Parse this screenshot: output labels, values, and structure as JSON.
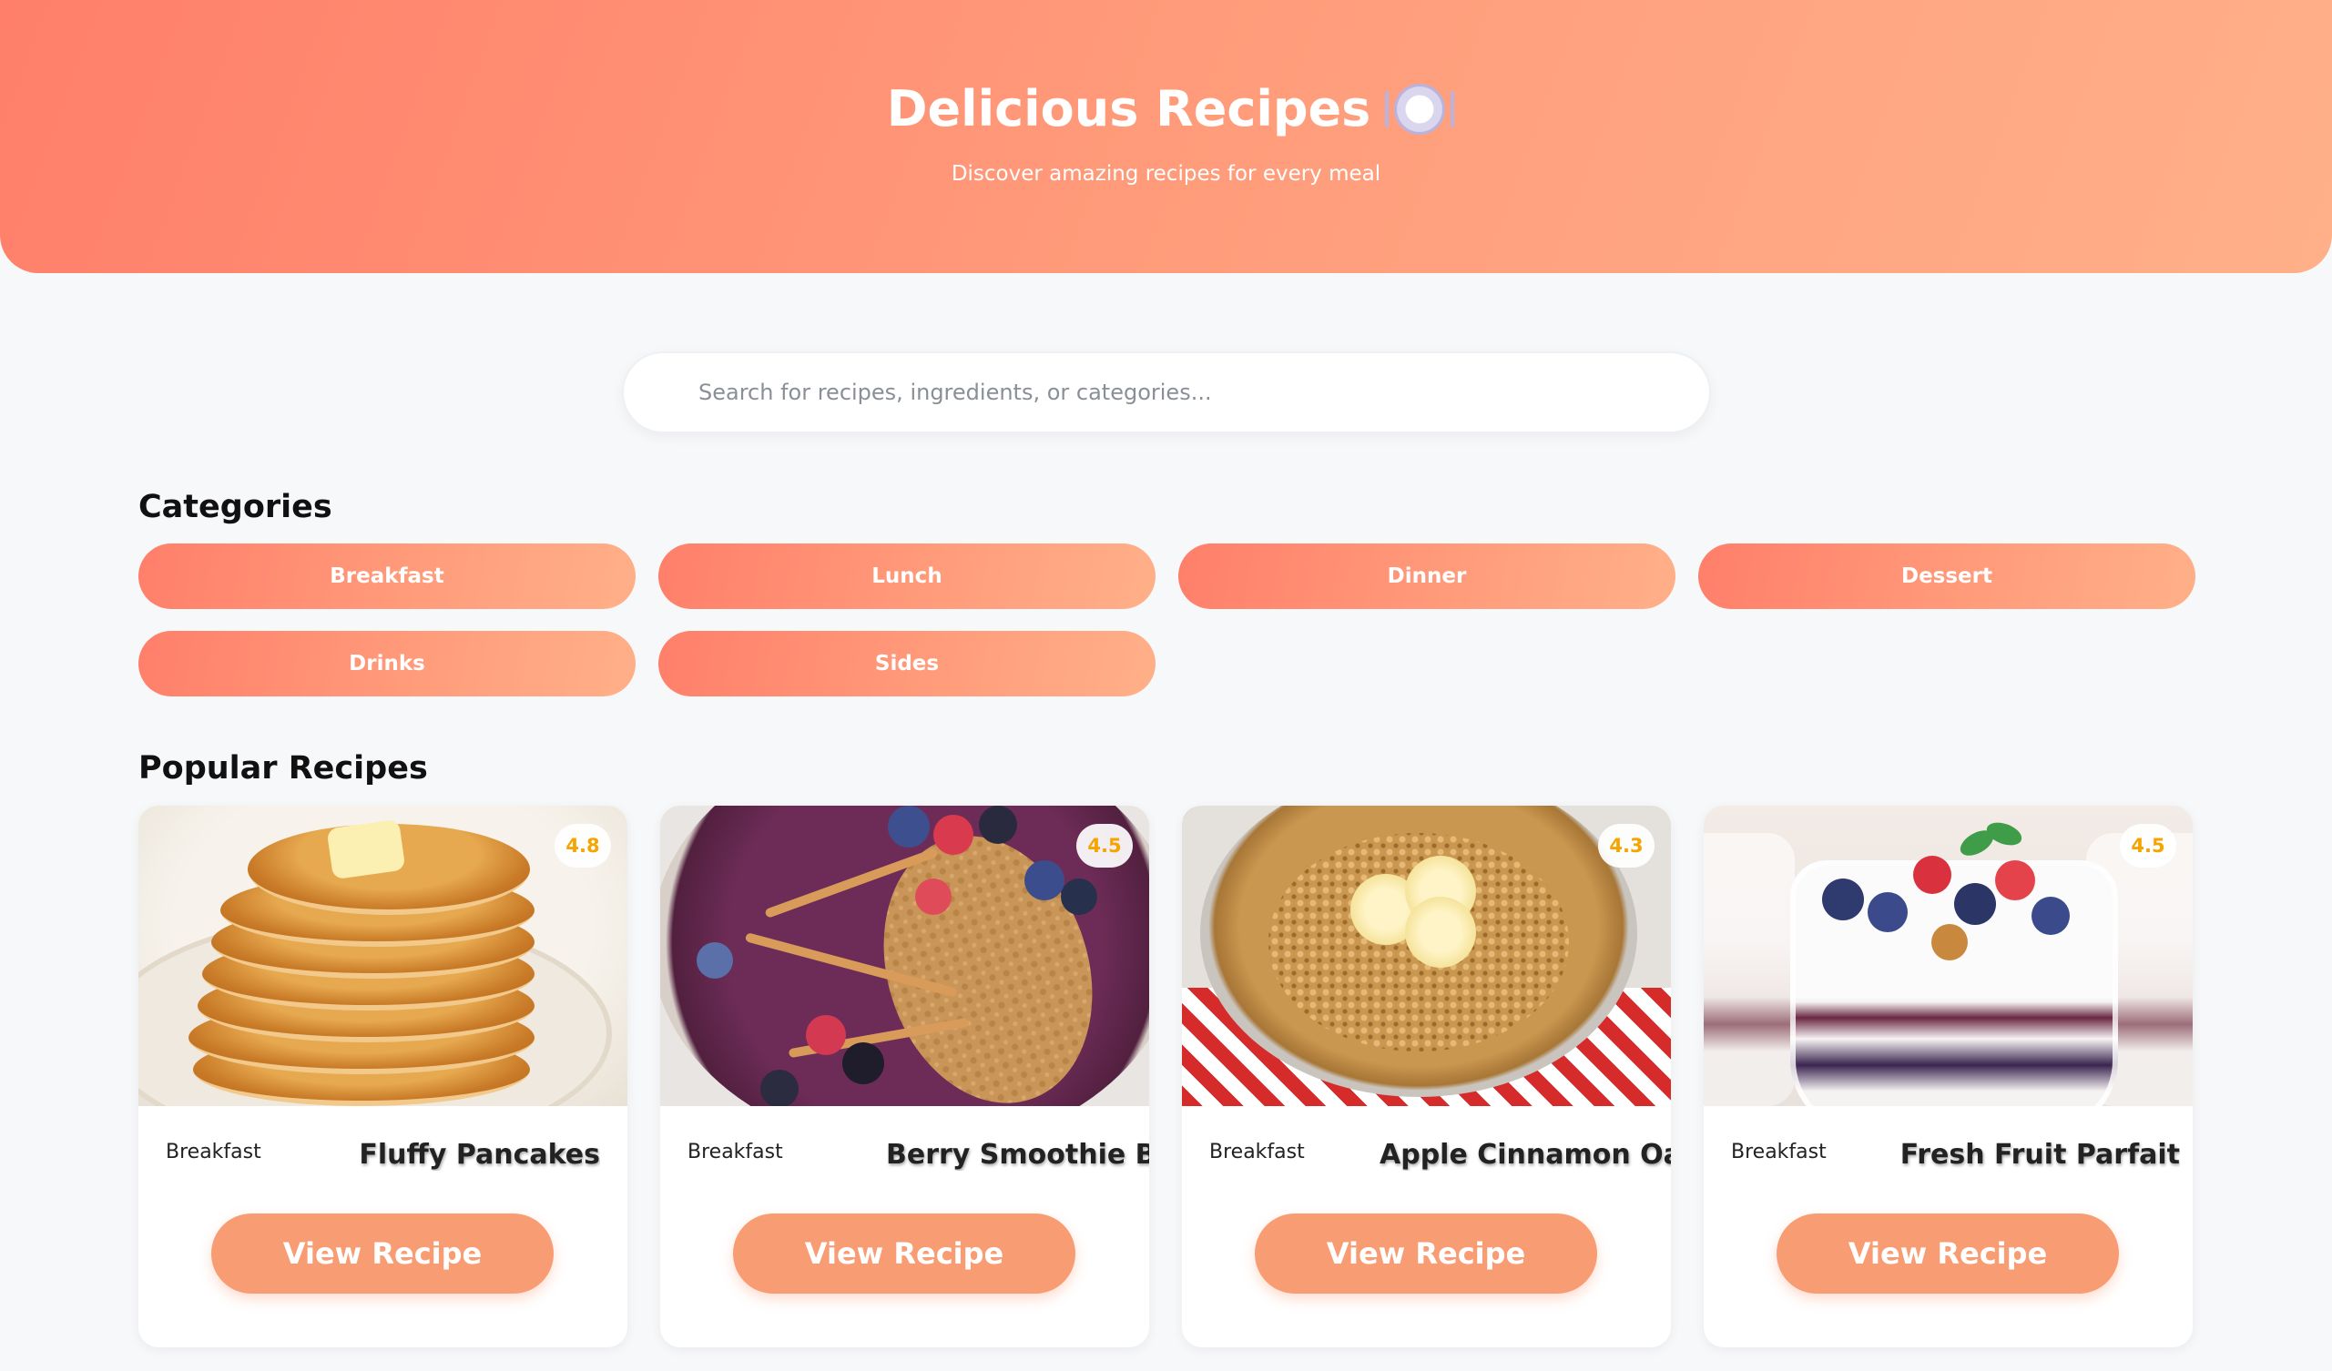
{
  "header": {
    "title": "Delicious Recipes",
    "icon": "plate-icon",
    "subtitle": "Discover amazing recipes for every meal"
  },
  "search": {
    "placeholder": "Search for recipes, ingredients, or categories..."
  },
  "categories": {
    "title": "Categories",
    "items": [
      "Breakfast",
      "Lunch",
      "Dinner",
      "Dessert",
      "Drinks",
      "Sides"
    ]
  },
  "popular": {
    "title": "Popular Recipes",
    "recipes": [
      {
        "category": "Breakfast",
        "name": "Fluffy Pancakes",
        "rating": "4.8",
        "button": "View Recipe"
      },
      {
        "category": "Breakfast",
        "name": "Berry Smoothie Bow",
        "rating": "4.5",
        "button": "View Recipe"
      },
      {
        "category": "Breakfast",
        "name": "Apple Cinnamon Oatm",
        "rating": "4.3",
        "button": "View Recipe"
      },
      {
        "category": "Breakfast",
        "name": "Fresh Fruit Parfait",
        "rating": "4.5",
        "button": "View Recipe"
      }
    ]
  },
  "colors": {
    "accent": "#ff8a6f",
    "button": "#f89c73",
    "rating": "#f5a400"
  }
}
